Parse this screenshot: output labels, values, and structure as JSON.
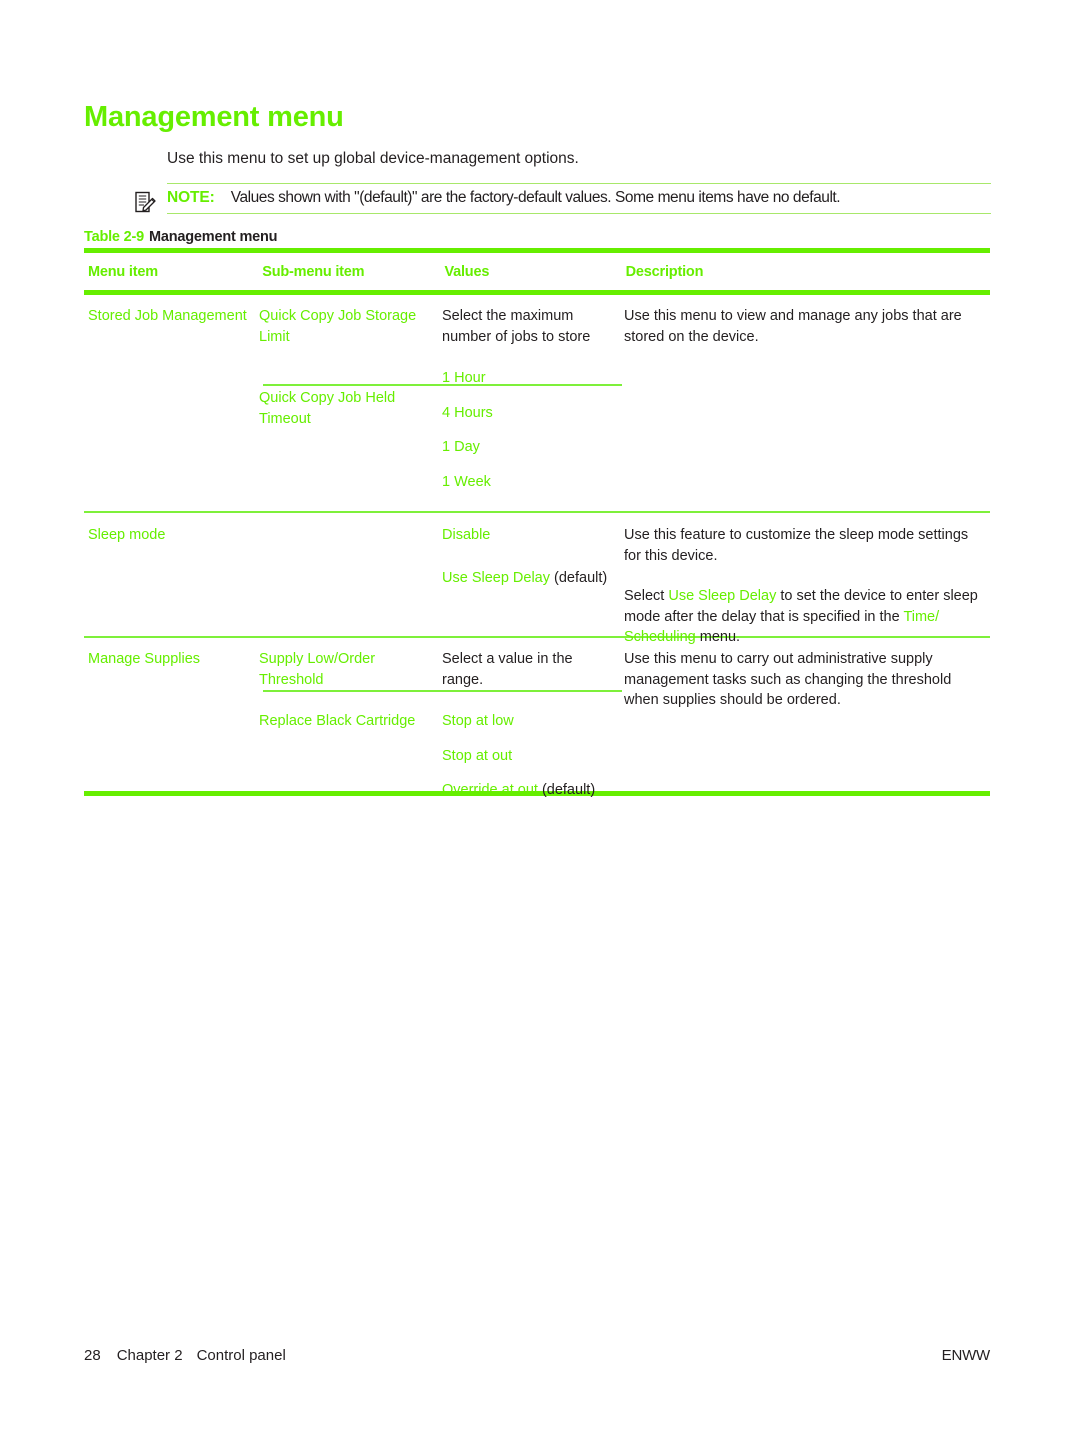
{
  "page": {
    "heading": "Management menu",
    "intro": "Use this menu to set up global device-management options."
  },
  "note": {
    "icon": "note-pencil-icon",
    "label": "NOTE:",
    "text": "Values shown with \"(default)\" are the factory-default values. Some menu items have no default."
  },
  "table_caption": {
    "number": "Table 2-9",
    "title": "Management menu"
  },
  "table": {
    "headers": {
      "menu_item": "Menu item",
      "sub_menu_item": "Sub-menu item",
      "values": "Values",
      "description": "Description"
    },
    "rows": [
      {
        "menu_item": "Stored Job Management",
        "description": "Use this menu to view and manage any jobs that are stored on the device.",
        "sub_rows": [
          {
            "sub_menu_item": "Quick Copy Job Storage Limit",
            "values": [
              "Select the maximum number of jobs to store"
            ],
            "values_style": "black"
          },
          {
            "sub_menu_item": "Quick Copy Job Held Timeout",
            "values": [
              "1 Hour",
              "4 Hours",
              "1 Day",
              "1 Week"
            ],
            "values_style": "green"
          }
        ]
      },
      {
        "menu_item": "Sleep mode",
        "description_parts": [
          {
            "text": "Use this feature to customize the sleep mode settings for this device.",
            "style": "black"
          }
        ],
        "description_para2": [
          {
            "text": "Select ",
            "style": "black"
          },
          {
            "text": "Use Sleep Delay",
            "style": "green"
          },
          {
            "text": " to set the device to enter sleep mode after the delay that is specified in the ",
            "style": "black"
          },
          {
            "text": "Time/ Scheduling",
            "style": "green"
          },
          {
            "text": " menu.",
            "style": "black"
          }
        ],
        "sub_rows": [
          {
            "sub_menu_item": "",
            "values_parts": [
              [
                {
                  "text": "Disable",
                  "style": "green"
                }
              ],
              [
                {
                  "text": "Use Sleep Delay",
                  "style": "green"
                },
                {
                  "text": " (default)",
                  "style": "black"
                }
              ]
            ]
          }
        ]
      },
      {
        "menu_item": "Manage Supplies",
        "description": "Use this menu to carry out administrative supply management tasks such as changing the threshold when supplies should be ordered.",
        "sub_rows": [
          {
            "sub_menu_item": "Supply Low/Order Threshold",
            "values": [
              "Select a value in the range."
            ],
            "values_style": "black"
          },
          {
            "sub_menu_item": "Replace Black Cartridge",
            "values_parts": [
              [
                {
                  "text": "Stop at low",
                  "style": "green"
                }
              ],
              [
                {
                  "text": "Stop at out",
                  "style": "green"
                }
              ],
              [
                {
                  "text": "Override at out",
                  "style": "green"
                },
                {
                  "text": " (default)",
                  "style": "black"
                }
              ]
            ]
          }
        ]
      }
    ]
  },
  "footer": {
    "page_number": "28",
    "chapter": "Chapter 2",
    "chapter_title": "Control panel",
    "right": "ENWW"
  },
  "colors": {
    "accent_green": "#66ee00",
    "rule_green": "#7ef03a",
    "note_rule_green": "#a8e86a",
    "text_black": "#231f20"
  }
}
